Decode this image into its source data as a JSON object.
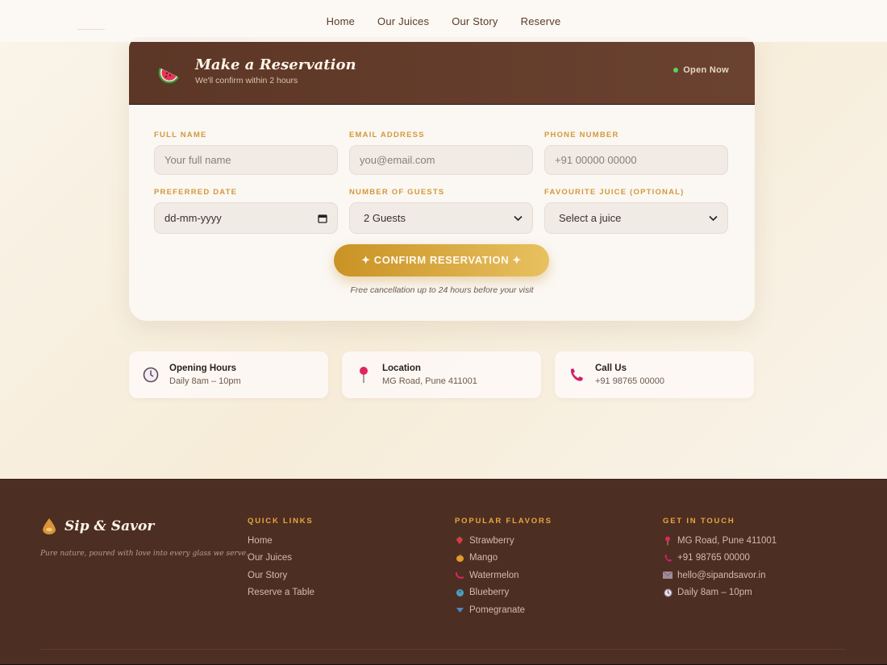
{
  "nav": {
    "items": [
      "Home",
      "Our Juices",
      "Our Story",
      "Reserve"
    ]
  },
  "reservation": {
    "title": "Make a Reservation",
    "subtitle": "We'll confirm within 2 hours",
    "status": "Open Now",
    "fields": {
      "name": {
        "label": "Full Name",
        "placeholder": "Your full name"
      },
      "email": {
        "label": "Email Address",
        "placeholder": "you@email.com"
      },
      "phone": {
        "label": "Phone Number",
        "placeholder": "+91 00000 00000"
      },
      "date": {
        "label": "Preferred Date",
        "placeholder": "dd-mm-yyyy"
      },
      "guests": {
        "label": "Number of Guests",
        "value": "2 Guests"
      },
      "juice": {
        "label": "Favourite Juice (Optional)",
        "value": "Select a juice"
      }
    },
    "confirm_label": "✦ CONFIRM RESERVATION ✦",
    "note": "Free cancellation up to 24 hours before your visit"
  },
  "info_cards": [
    {
      "title": "Opening Hours",
      "detail": "Daily 8am – 10pm",
      "icon": "clock-icon"
    },
    {
      "title": "Location",
      "detail": "MG Road, Pune 411001",
      "icon": "pin-icon"
    },
    {
      "title": "Call Us",
      "detail": "+91 98765 00000",
      "icon": "phone-icon"
    }
  ],
  "footer": {
    "brand": "Sip & Savor",
    "tagline": "Pure nature, poured with love into every glass we serve.",
    "quick_links": {
      "heading": "QUICK LINKS",
      "items": [
        "Home",
        "Our Juices",
        "Our Story",
        "Reserve a Table"
      ]
    },
    "flavors": {
      "heading": "POPULAR FLAVORS",
      "items": [
        "Strawberry",
        "Mango",
        "Watermelon",
        "Blueberry",
        "Pomegranate"
      ]
    },
    "contact": {
      "heading": "GET IN TOUCH",
      "items": [
        "MG Road, Pune 411001",
        "+91 98765 00000",
        "hello@sipandsavor.in",
        "Daily 8am – 10pm"
      ]
    }
  },
  "colors": {
    "accent": "#d19a3a",
    "header_brown": "#5c3626",
    "footer_brown": "#4d2e22",
    "button_gold": "#c99224"
  }
}
